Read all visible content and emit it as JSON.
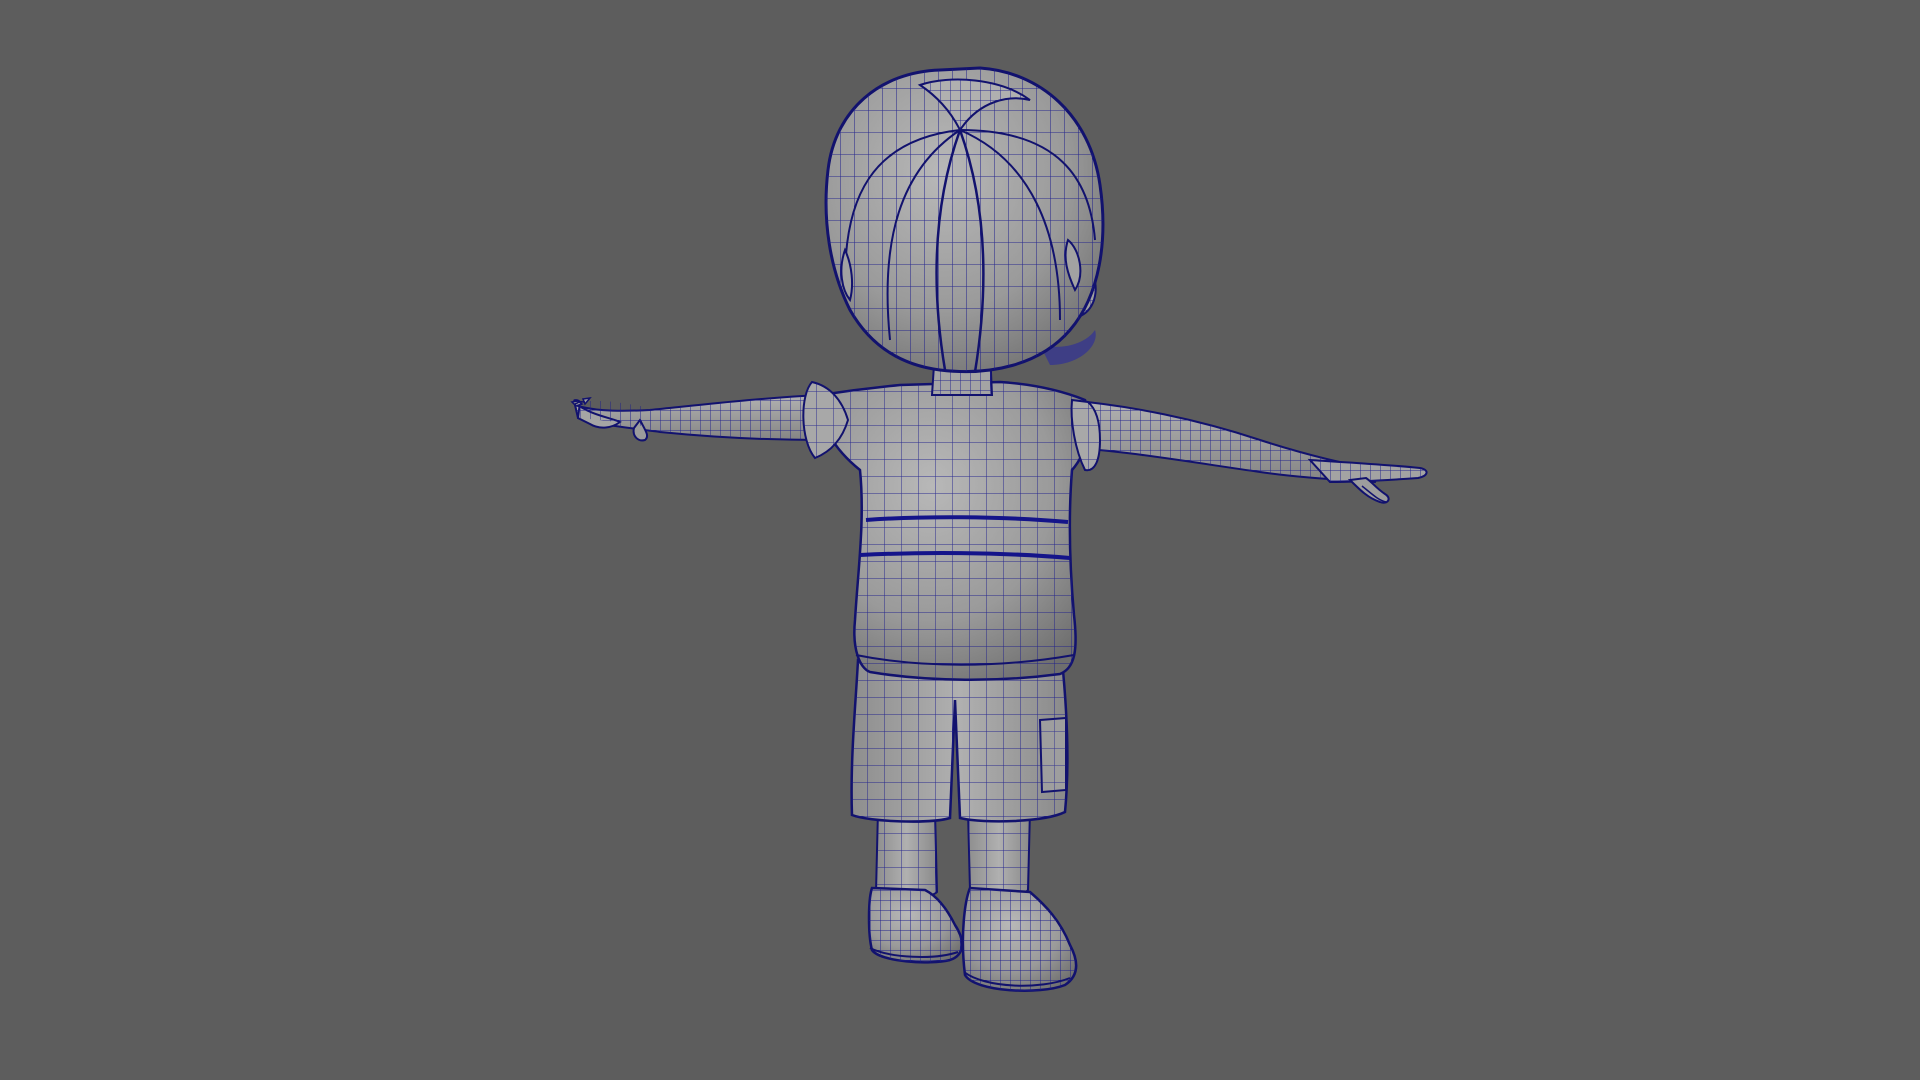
{
  "viewport": {
    "background_color": "#5d5d5d",
    "view_label": "",
    "display_mode": "wireframe-on-shaded"
  },
  "model": {
    "kind": "character-mesh",
    "pose": "t-pose",
    "view": "back",
    "shading_color": "#9a9a9a",
    "shading_dark": "#6f6f6f",
    "shading_light": "#b4b4b4",
    "wire_color": "#1c1c8c",
    "outline_color": "#12126e"
  }
}
